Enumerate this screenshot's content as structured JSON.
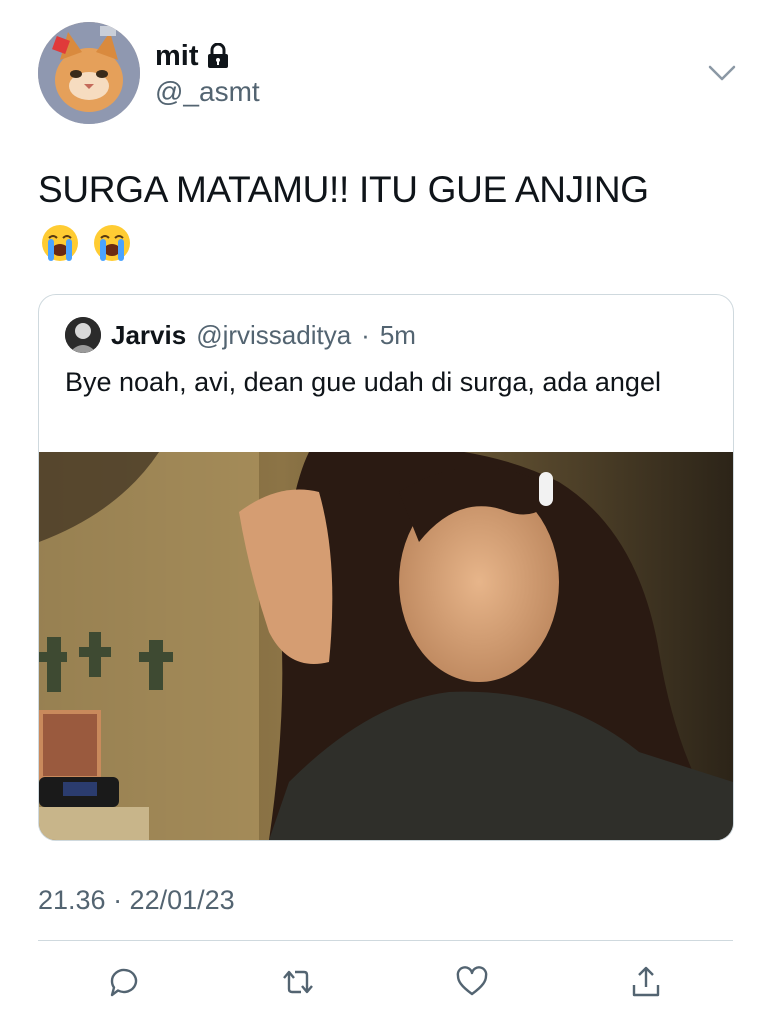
{
  "author": {
    "display_name": "mit",
    "handle": "@_asmt",
    "protected_icon": "lock-icon",
    "avatar": "cat-avatar"
  },
  "tweet": {
    "text": "SURGA MATAMU!! ITU GUE ANJING",
    "emojis": [
      "loudly-crying-face",
      "loudly-crying-face"
    ],
    "timestamp": "21.36 · 22/01/23"
  },
  "quoted_tweet": {
    "display_name": "Jarvis",
    "handle": "@jrvissaditya",
    "separator": "·",
    "time": "5m",
    "text": "Bye noah, avi, dean gue udah di surga, ada angel",
    "media": "photo-woman-with-long-hair"
  },
  "actions": {
    "reply_icon": "reply-icon",
    "retweet_icon": "retweet-icon",
    "like_icon": "heart-icon",
    "share_icon": "share-icon"
  },
  "colors": {
    "text": "#0f1419",
    "secondary": "#536471",
    "border": "#cfd9de",
    "icon": "#536471"
  }
}
